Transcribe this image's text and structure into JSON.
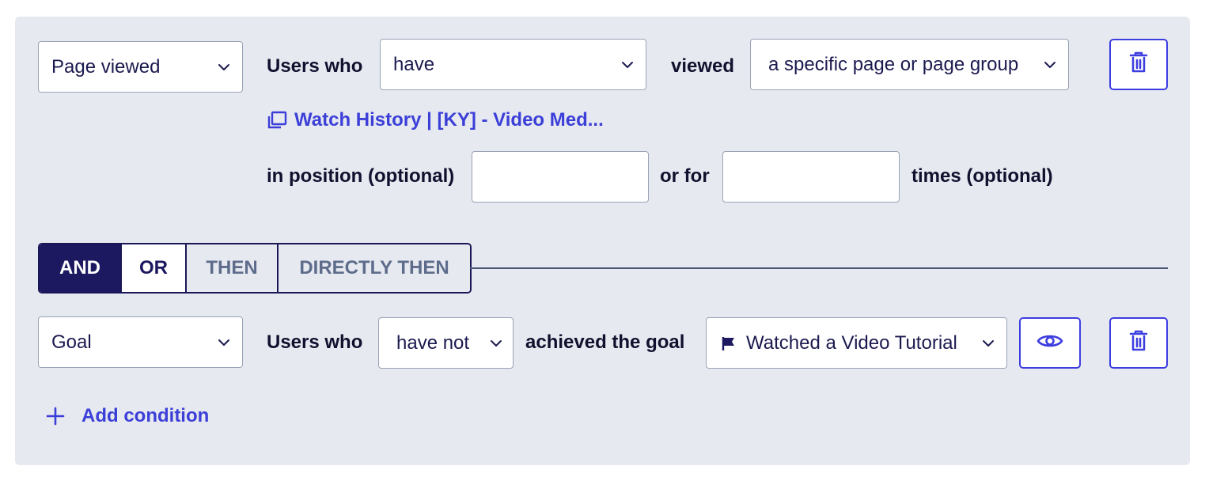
{
  "condition1": {
    "type_select": "Page viewed",
    "users_who_label": "Users who",
    "have_select": "have",
    "viewed_label": "viewed",
    "page_select": "a specific page or page group",
    "page_link": "Watch History | [KY] - Video Med...",
    "position_label": "in position (optional)",
    "position_value": "",
    "or_for_label": "or for",
    "times_value": "",
    "times_label": "times (optional)"
  },
  "connector": {
    "and": "AND",
    "or": "OR",
    "then": "THEN",
    "directly_then": "DIRECTLY THEN",
    "selected": "AND"
  },
  "condition2": {
    "type_select": "Goal",
    "users_who_label": "Users who",
    "have_select": "have not",
    "achieved_label": "achieved the goal",
    "goal_select": "Watched a Video Tutorial"
  },
  "add_condition": "Add condition",
  "icons": [
    "chevron-down-icon",
    "trash-icon",
    "pages-icon",
    "flag-icon",
    "eye-icon",
    "plus-icon"
  ],
  "colors": {
    "accent": "#3d3ee0",
    "navy": "#1c1960",
    "panel": "#e6e9ef"
  }
}
